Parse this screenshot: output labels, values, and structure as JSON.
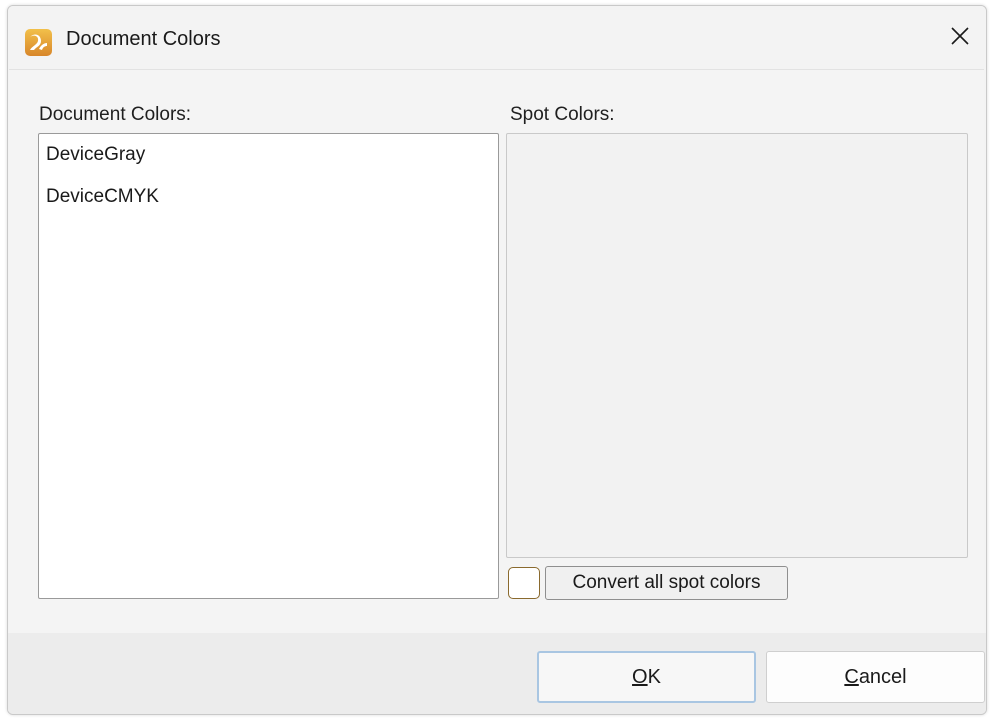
{
  "window": {
    "title": "Document Colors",
    "icon": "app-logo-icon",
    "close_icon": "close-icon"
  },
  "document_colors": {
    "label": "Document Colors:",
    "items": [
      "DeviceGray",
      "DeviceCMYK"
    ]
  },
  "spot_colors": {
    "label": "Spot Colors:",
    "items": [],
    "convert_checkbox_checked": false,
    "convert_label": "Convert all spot colors"
  },
  "buttons": {
    "ok_mnemonic": "O",
    "ok_rest": "K",
    "cancel_mnemonic": "C",
    "cancel_rest": "ancel"
  },
  "colors": {
    "accent_focus": "#a9c6e2",
    "checkbox_border": "#8a6a2e",
    "logo_orange": "#e8a23a"
  }
}
